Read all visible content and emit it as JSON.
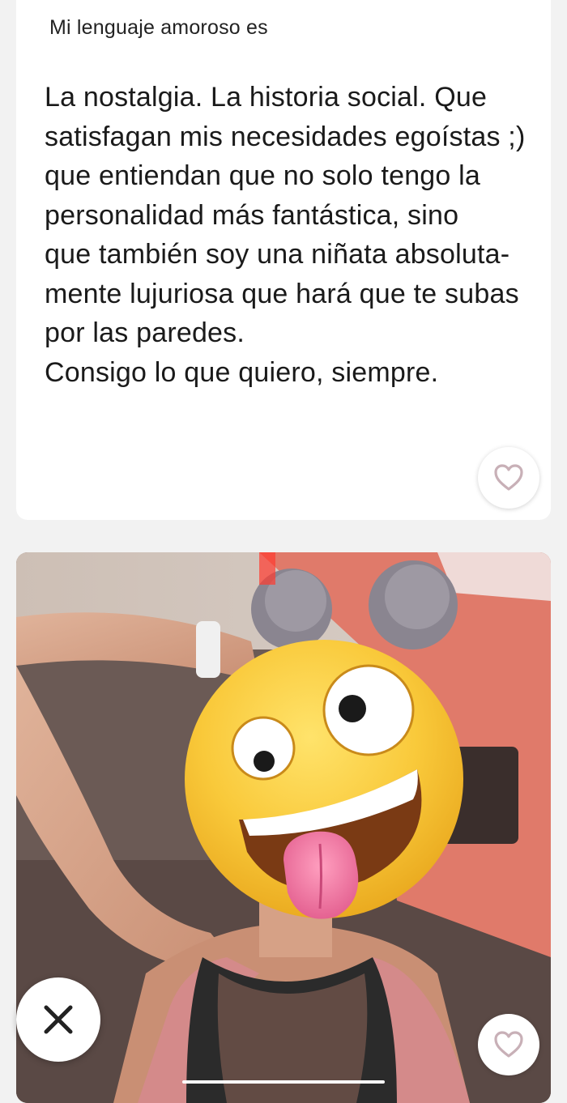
{
  "prompt": {
    "label": "Mi lenguaje amoroso es",
    "answer": "La nostalgia. La historia social. Que\nsatisfagan mis necesidades egoístas ;)\nque entiendan que no solo tengo la\npersonalidad más fantástica, sino\nque también soy una niñata absoluta-\nmente lujuriosa que hará que te subas\npor las paredes.\nConsigo lo que quiero, siempre.",
    "like_icon": "heart-outline-icon"
  },
  "photo": {
    "overlay_emoji": "zany-face-emoji",
    "like_icon": "heart-outline-icon"
  },
  "actions": {
    "dismiss_icon": "x-icon"
  },
  "colors": {
    "background": "#f2f2f2",
    "card": "#ffffff",
    "heart_stroke": "#c8b0b7",
    "dismiss_icon": "#222222"
  }
}
